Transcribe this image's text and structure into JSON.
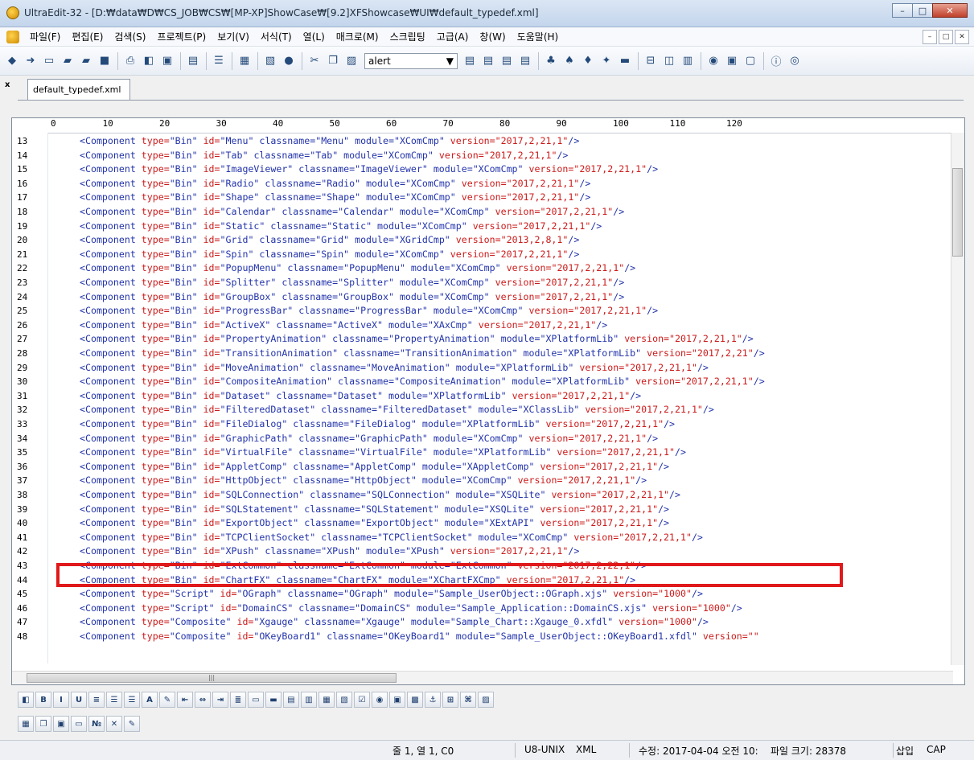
{
  "window": {
    "title": "UltraEdit-32 - [D:₩data₩D₩CS_JOB₩CS₩[MP-XP]ShowCase₩[9.2]XFShowcase₩UI₩default_typedef.xml]",
    "minimize": "–",
    "maximize": "□",
    "close": "✕"
  },
  "menu": [
    "파일(F)",
    "편집(E)",
    "검색(S)",
    "프로젝트(P)",
    "보기(V)",
    "서식(T)",
    "열(L)",
    "매크로(M)",
    "스크립팅",
    "고급(A)",
    "창(W)",
    "도움말(H)"
  ],
  "toolbar": {
    "search_combo_value": "alert"
  },
  "tab": {
    "label": "default_typedef.xml",
    "close": "x"
  },
  "ruler": [
    "0",
    "10",
    "20",
    "30",
    "40",
    "50",
    "60",
    "70",
    "80",
    "90",
    "100",
    "110",
    "120"
  ],
  "lines": [
    {
      "n": "13",
      "id": "Menu",
      "cls": "Menu",
      "mod": "XComCmp",
      "ver": "2017,2,21,1"
    },
    {
      "n": "14",
      "id": "Tab",
      "cls": "Tab",
      "mod": "XComCmp",
      "ver": "2017,2,21,1"
    },
    {
      "n": "15",
      "id": "ImageViewer",
      "cls": "ImageViewer",
      "mod": "XComCmp",
      "ver": "2017,2,21,1"
    },
    {
      "n": "16",
      "id": "Radio",
      "cls": "Radio",
      "mod": "XComCmp",
      "ver": "2017,2,21,1"
    },
    {
      "n": "17",
      "id": "Shape",
      "cls": "Shape",
      "mod": "XComCmp",
      "ver": "2017,2,21,1"
    },
    {
      "n": "18",
      "id": "Calendar",
      "cls": "Calendar",
      "mod": "XComCmp",
      "ver": "2017,2,21,1"
    },
    {
      "n": "19",
      "id": "Static",
      "cls": "Static",
      "mod": "XComCmp",
      "ver": "2017,2,21,1"
    },
    {
      "n": "20",
      "id": "Grid",
      "cls": "Grid",
      "mod": "XGridCmp",
      "ver": "2013,2,8,1"
    },
    {
      "n": "21",
      "id": "Spin",
      "cls": "Spin",
      "mod": "XComCmp",
      "ver": "2017,2,21,1"
    },
    {
      "n": "22",
      "id": "PopupMenu",
      "cls": "PopupMenu",
      "mod": "XComCmp",
      "ver": "2017,2,21,1"
    },
    {
      "n": "23",
      "id": "Splitter",
      "cls": "Splitter",
      "mod": "XComCmp",
      "ver": "2017,2,21,1"
    },
    {
      "n": "24",
      "id": "GroupBox",
      "cls": "GroupBox",
      "mod": "XComCmp",
      "ver": "2017,2,21,1"
    },
    {
      "n": "25",
      "id": "ProgressBar",
      "cls": "ProgressBar",
      "mod": "XComCmp",
      "ver": "2017,2,21,1"
    },
    {
      "n": "26",
      "id": "ActiveX",
      "cls": "ActiveX",
      "mod": "XAxCmp",
      "ver": "2017,2,21,1"
    },
    {
      "n": "27",
      "id": "PropertyAnimation",
      "cls": "PropertyAnimation",
      "mod": "XPlatformLib",
      "ver": "2017,2,21,1"
    },
    {
      "n": "28",
      "id": "TransitionAnimation",
      "cls": "TransitionAnimation",
      "mod": "XPlatformLib",
      "ver": "2017,2,21"
    },
    {
      "n": "29",
      "id": "MoveAnimation",
      "cls": "MoveAnimation",
      "mod": "XPlatformLib",
      "ver": "2017,2,21,1"
    },
    {
      "n": "30",
      "id": "CompositeAnimation",
      "cls": "CompositeAnimation",
      "mod": "XPlatformLib",
      "ver": "2017,2,21,1"
    },
    {
      "n": "31",
      "id": "Dataset",
      "cls": "Dataset",
      "mod": "XPlatformLib",
      "ver": "2017,2,21,1"
    },
    {
      "n": "32",
      "id": "FilteredDataset",
      "cls": "FilteredDataset",
      "mod": "XClassLib",
      "ver": "2017,2,21,1"
    },
    {
      "n": "33",
      "id": "FileDialog",
      "cls": "FileDialog",
      "mod": "XPlatformLib",
      "ver": "2017,2,21,1"
    },
    {
      "n": "34",
      "id": "GraphicPath",
      "cls": "GraphicPath",
      "mod": "XComCmp",
      "ver": "2017,2,21,1"
    },
    {
      "n": "35",
      "id": "VirtualFile",
      "cls": "VirtualFile",
      "mod": "XPlatformLib",
      "ver": "2017,2,21,1"
    },
    {
      "n": "36",
      "id": "AppletComp",
      "cls": "AppletComp",
      "mod": "XAppletComp",
      "ver": "2017,2,21,1"
    },
    {
      "n": "37",
      "id": "HttpObject",
      "cls": "HttpObject",
      "mod": "XComCmp",
      "ver": "2017,2,21,1"
    },
    {
      "n": "38",
      "id": "SQLConnection",
      "cls": "SQLConnection",
      "mod": "XSQLite",
      "ver": "2017,2,21,1"
    },
    {
      "n": "39",
      "id": "SQLStatement",
      "cls": "SQLStatement",
      "mod": "XSQLite",
      "ver": "2017,2,21,1"
    },
    {
      "n": "40",
      "id": "ExportObject",
      "cls": "ExportObject",
      "mod": "XExtAPI",
      "ver": "2017,2,21,1"
    },
    {
      "n": "41",
      "id": "TCPClientSocket",
      "cls": "TCPClientSocket",
      "mod": "XComCmp",
      "ver": "2017,2,21,1"
    },
    {
      "n": "42",
      "id": "XPush",
      "cls": "XPush",
      "mod": "XPush",
      "ver": "2017,2,21,1"
    },
    {
      "n": "43",
      "id": "ExtCommon",
      "cls": "ExtCommon",
      "mod": "ExtCommon",
      "ver": "2017,2,22,1"
    },
    {
      "n": "44",
      "id": "ChartFX",
      "cls": "ChartFX",
      "mod": "XChartFXCmp",
      "ver": "2017,2,21,1"
    },
    {
      "n": "45",
      "type": "Script",
      "id": "OGraph",
      "cls": "OGraph",
      "mod": "Sample_UserObject::OGraph.xjs",
      "ver": "1000"
    },
    {
      "n": "46",
      "type": "Script",
      "id": "DomainCS",
      "cls": "DomainCS",
      "mod": "Sample_Application::DomainCS.xjs",
      "ver": "1000"
    },
    {
      "n": "47",
      "type": "Composite",
      "id": "Xgauge",
      "cls": "Xgauge",
      "mod": "Sample_Chart::Xgauge_0.xfdl",
      "ver": "1000"
    },
    {
      "n": "48",
      "type": "Composite",
      "id": "OKeyBoard1",
      "cls": "OKeyBoard1",
      "mod": "Sample_UserObject::OKeyBoard1.xfdl",
      "ver": ""
    }
  ],
  "fmt_buttons": [
    "B",
    "I",
    "U"
  ],
  "status": {
    "position": "줄 1, 열 1, C0",
    "encoding": "U8-UNIX",
    "filetype": "XML",
    "modified": "수정: 2017-04-04 오전 10:",
    "filesize": "파일 크기: 28378",
    "insert": "삽입",
    "caps": "CAP"
  },
  "colors": {
    "highlight": "#e0191b",
    "tag": "#2233aa",
    "attr": "#cc1a1a"
  }
}
